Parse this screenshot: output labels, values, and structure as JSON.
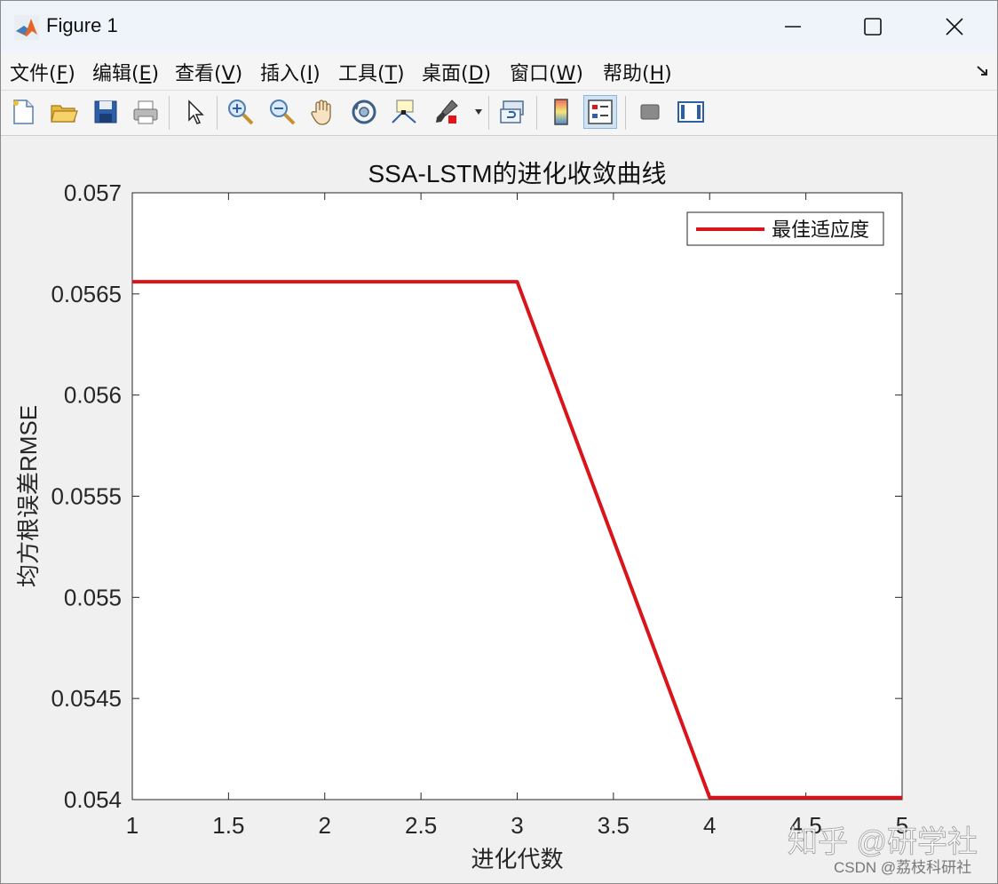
{
  "window": {
    "title": "Figure 1",
    "controls": {
      "minimize": "minimize",
      "maximize": "maximize",
      "close": "close"
    }
  },
  "menu": {
    "items": [
      {
        "label": "文件(",
        "key": "F",
        "end": ")"
      },
      {
        "label": "编辑(",
        "key": "E",
        "end": ")"
      },
      {
        "label": "查看(",
        "key": "V",
        "end": ")"
      },
      {
        "label": "插入(",
        "key": "I",
        "end": ")"
      },
      {
        "label": "工具(",
        "key": "T",
        "end": ")"
      },
      {
        "label": "桌面(",
        "key": "D",
        "end": ")"
      },
      {
        "label": "窗口(",
        "key": "W",
        "end": ")"
      },
      {
        "label": "帮助(",
        "key": "H",
        "end": ")"
      }
    ]
  },
  "toolbar": {
    "buttons": [
      "new-figure-icon",
      "open-file-icon",
      "save-icon",
      "print-icon",
      "select-pointer-icon",
      "zoom-in-icon",
      "zoom-out-icon",
      "pan-hand-icon",
      "rotate-3d-icon",
      "data-cursor-icon",
      "brush-icon",
      "link-plot-icon",
      "colorbar-icon",
      "legend-icon",
      "hide-plot-tools-icon",
      "show-plot-tools-icon"
    ]
  },
  "colors": {
    "line": "#d9141b",
    "axes_bg": "#ffffff",
    "figure_bg": "#f0f0f0"
  },
  "chart_data": {
    "type": "line",
    "title": "SSA-LSTM的进化收敛曲线",
    "xlabel": "进化代数",
    "ylabel": "均方根误差RMSE",
    "xlim": [
      1,
      5
    ],
    "ylim": [
      0.054,
      0.057
    ],
    "xticks": [
      "1",
      "1.5",
      "2",
      "2.5",
      "3",
      "3.5",
      "4",
      "4.5",
      "5"
    ],
    "yticks": [
      "0.054",
      "0.0545",
      "0.055",
      "0.0555",
      "0.056",
      "0.0565",
      "0.057"
    ],
    "grid": false,
    "legend_position": "top-right",
    "series": [
      {
        "name": "最佳适应度",
        "color": "#d9141b",
        "x": [
          1,
          2,
          3,
          4,
          5
        ],
        "y": [
          0.05656,
          0.05656,
          0.05656,
          0.05401,
          0.05401
        ]
      }
    ]
  },
  "watermark": {
    "main": "知乎 @研学社",
    "sub": "CSDN @荔枝科研社"
  }
}
